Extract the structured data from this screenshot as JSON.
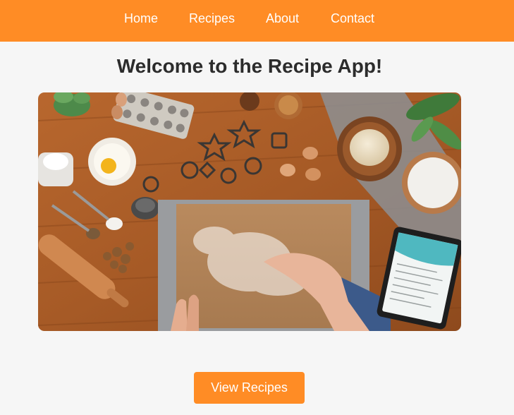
{
  "nav": {
    "items": [
      {
        "label": "Home"
      },
      {
        "label": "Recipes"
      },
      {
        "label": "About"
      },
      {
        "label": "Contact"
      }
    ]
  },
  "main": {
    "title": "Welcome to the Recipe App!",
    "hero_alt": "Baking ingredients on a wooden kitchen table"
  },
  "cta": {
    "label": "View Recipes"
  },
  "colors": {
    "accent": "#ff8c25",
    "background": "#f6f6f6",
    "title": "#2c2c2c"
  }
}
